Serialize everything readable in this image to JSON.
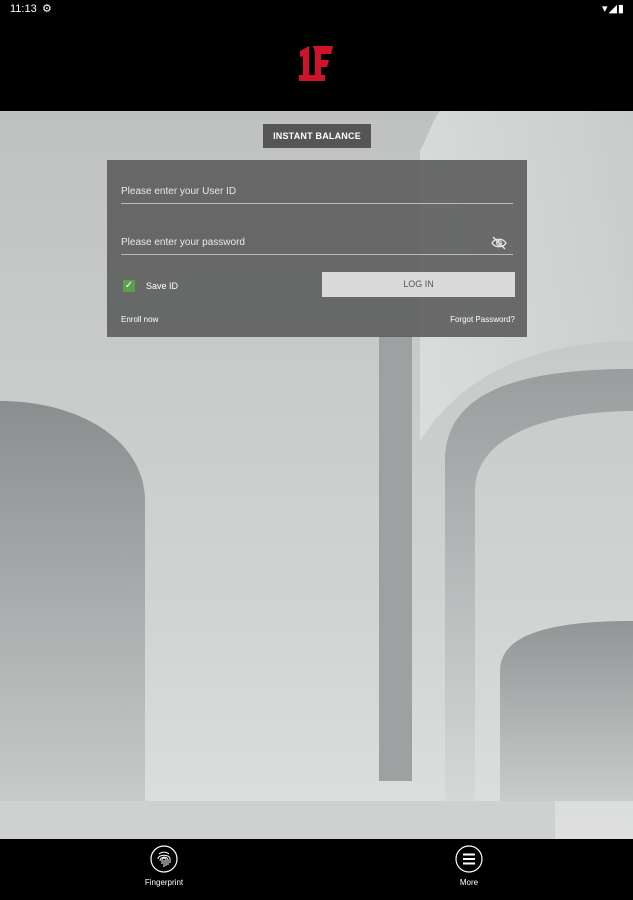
{
  "status_bar": {
    "time": "11:13",
    "settings_glyph": "⚙",
    "right_icons": "▾◢▮"
  },
  "header": {
    "logo_text": "1F",
    "brand_color": "#d0132a"
  },
  "main": {
    "instant_balance_label": "INSTANT BALANCE",
    "login": {
      "user_id_placeholder": "Please enter your User ID",
      "password_placeholder": "Please enter your password",
      "save_id_label": "Save ID",
      "save_id_checked": true,
      "login_button_label": "LOG IN",
      "enroll_link": "Enroll now",
      "forgot_link": "Forgot Password?"
    }
  },
  "bottom_nav": {
    "items": [
      {
        "label": "Fingerprint",
        "icon": "fingerprint-icon"
      },
      {
        "label": "More",
        "icon": "menu-icon"
      }
    ]
  }
}
